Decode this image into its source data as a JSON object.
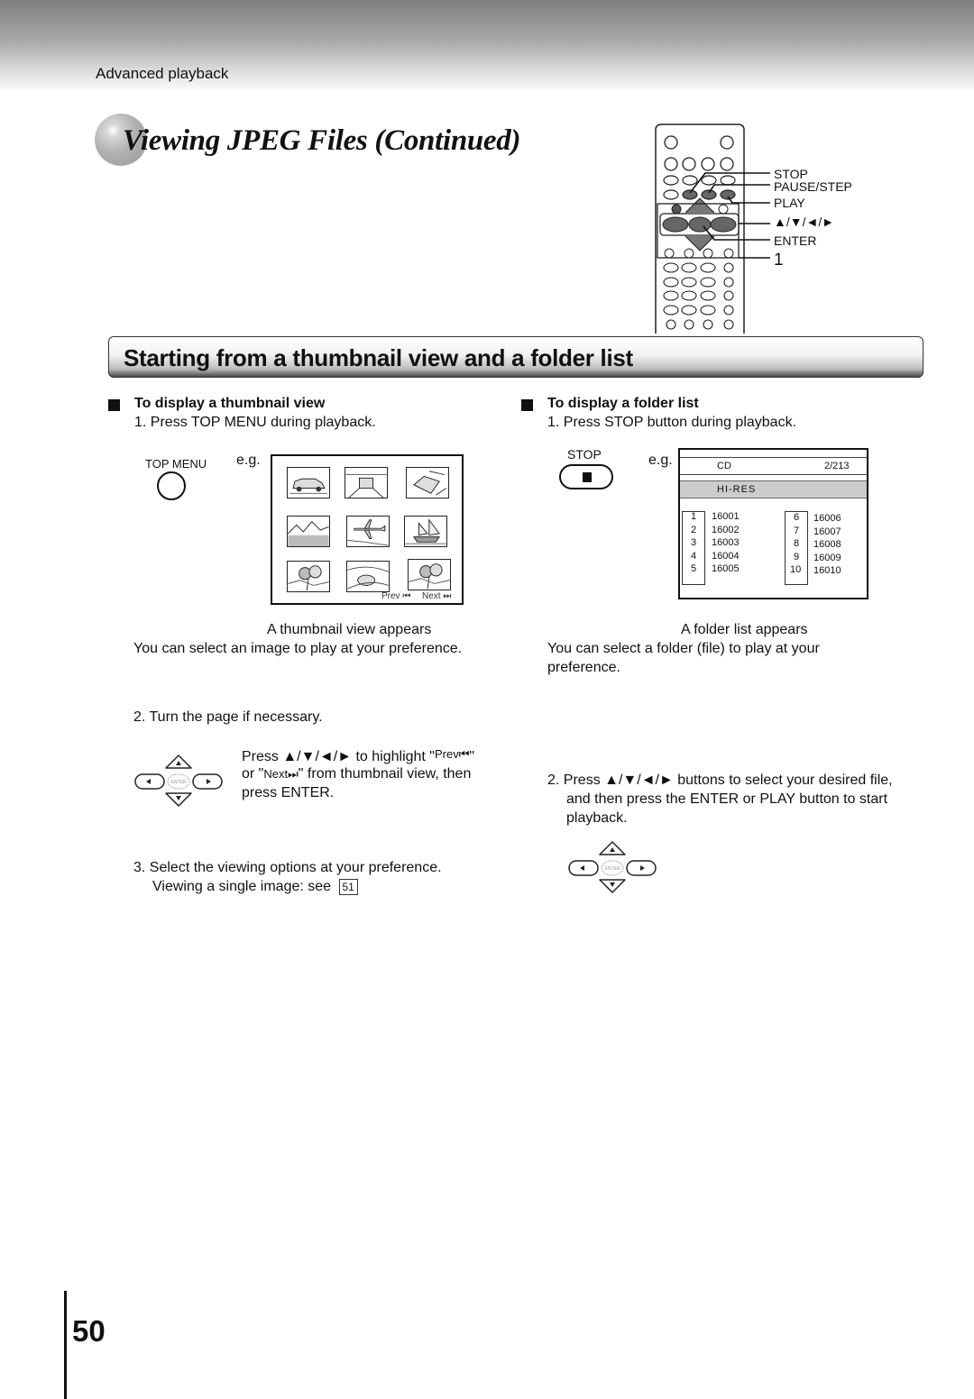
{
  "header": {
    "section": "Advanced playback",
    "title": "Viewing JPEG Files (Continued)"
  },
  "remote": {
    "labels": {
      "stop": "STOP",
      "pause_step": "PAUSE/STEP",
      "play": "PLAY",
      "arrows": "▲/▼/◄/►",
      "enter": "ENTER",
      "step_ref": "1"
    }
  },
  "banner": {
    "title": "Starting from a thumbnail view and a folder list"
  },
  "left": {
    "heading": "To display a thumbnail view",
    "step1": "1. Press TOP MENU during playback.",
    "button_label": "TOP MENU",
    "eg": "e.g.",
    "thumbnails": [
      "car-side",
      "car-front",
      "car-angle",
      "mountains",
      "airplane",
      "sailing-ship",
      "flowers",
      "car-road",
      "flowers"
    ],
    "prev_label": "Prev ⏮",
    "next_label": "Next ⏭",
    "result_line1": "A  thumbnail view appears",
    "result_line2": "You can select an image to play at your preference.",
    "step2": "2. Turn the page if necessary.",
    "step2_detail": {
      "line1_a": "Press ▲/▼/◄/► to highlight \"",
      "line1_prev": "Prev⏮",
      "line1_b": "\"",
      "line2_a": "or \"",
      "line2_next": "Next⏭",
      "line2_b": "\" from thumbnail view, then",
      "line3": "press ENTER."
    },
    "step3_line1": "3. Select the viewing options at your preference.",
    "step3_line2": "Viewing a single image: see",
    "step3_ref": "51"
  },
  "right": {
    "heading": "To display a folder list",
    "step1": "1. Press STOP button during playback.",
    "button_label": "STOP",
    "eg": "e.g.",
    "folder_list": {
      "source": "CD",
      "counter": "2/213",
      "folder": "HI-RES",
      "items_col1": [
        {
          "num": "1",
          "name": "16001"
        },
        {
          "num": "2",
          "name": "16002"
        },
        {
          "num": "3",
          "name": "16003"
        },
        {
          "num": "4",
          "name": "16004"
        },
        {
          "num": "5",
          "name": "16005"
        }
      ],
      "items_col2": [
        {
          "num": "6",
          "name": "16006"
        },
        {
          "num": "7",
          "name": "16007"
        },
        {
          "num": "8",
          "name": "16008"
        },
        {
          "num": "9",
          "name": "16009"
        },
        {
          "num": "10",
          "name": "16010"
        }
      ]
    },
    "result_line1": "A folder list appears",
    "result_line2": "You can select a folder (file) to play at your",
    "result_line3": "preference.",
    "step2_line1": "2. Press ▲/▼/◄/► buttons to select your desired file,",
    "step2_line2": "and then press the ENTER or PLAY button to start",
    "step2_line3": "playback."
  },
  "dpad": {
    "center_label": "ENTER"
  },
  "footer": {
    "page_number": "50"
  }
}
